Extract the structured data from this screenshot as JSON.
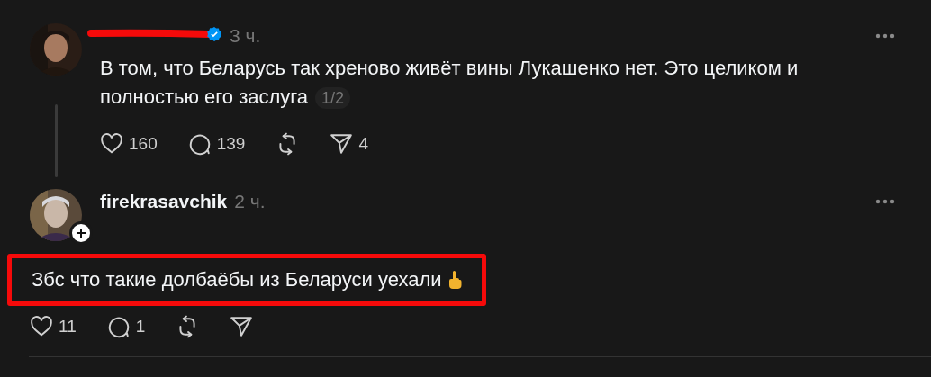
{
  "posts": [
    {
      "redacted": true,
      "verified": true,
      "time": "3 ч.",
      "text": "В том, что Беларусь так хреново живёт вины Лукашенко нет. Это целиком и полностью его заслуга",
      "page": "1/2",
      "thread_line": true,
      "follow_badge": false,
      "indented": true,
      "highlighted": false,
      "actions": [
        {
          "kind": "like",
          "count": "160"
        },
        {
          "kind": "reply",
          "count": "139"
        },
        {
          "kind": "repost"
        },
        {
          "kind": "share",
          "count": "4"
        }
      ]
    },
    {
      "username": "firekrasavchik",
      "redacted": false,
      "verified": false,
      "time": "2 ч.",
      "text": "Збс что такие долбаёбы из Беларуси уехали",
      "thread_line": false,
      "follow_badge": true,
      "indented": false,
      "highlighted": true,
      "actions": [
        {
          "kind": "like",
          "count": "11"
        },
        {
          "kind": "reply",
          "count": "1"
        },
        {
          "kind": "repost"
        },
        {
          "kind": "share"
        }
      ]
    }
  ]
}
